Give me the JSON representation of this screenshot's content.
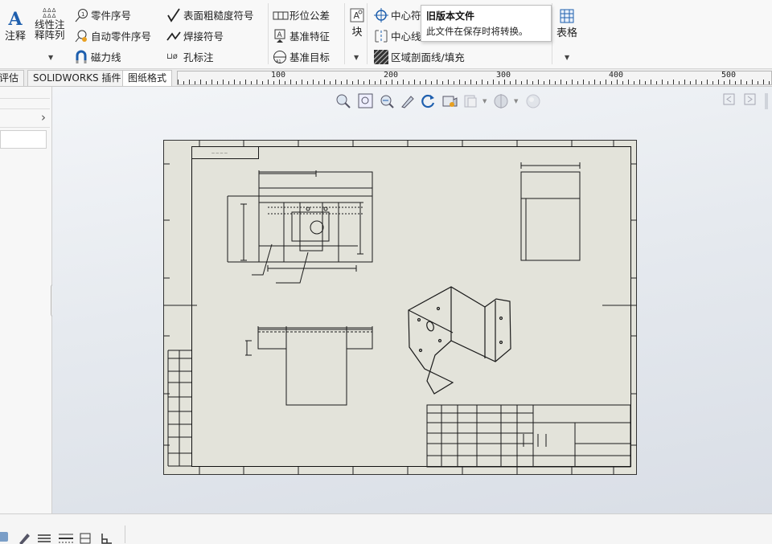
{
  "ribbon": {
    "annotation": "注释",
    "linear_pattern": [
      "线性注",
      "释阵列"
    ],
    "balloon": "零件序号",
    "auto_balloon": "自动零件序号",
    "magnetic_line": "磁力线",
    "surface_finish": "表面粗糙度符号",
    "weld_symbol": "焊接符号",
    "hole_callout": "孔标注",
    "geometric_tolerance": "形位公差",
    "datum_feature": "基准特征",
    "datum_target": "基准目标",
    "block": "块",
    "center_mark": "中心符",
    "centerline": "中心线",
    "area_hatch": "区域剖面线/填充",
    "table": "表格",
    "tooltip_title": "旧版本文件",
    "tooltip_text": "此文件在保存时将转换。"
  },
  "tabs": [
    "评估",
    "SOLIDWORKS 插件",
    "图纸格式"
  ],
  "ruler_labels": [
    "100",
    "200",
    "300",
    "400",
    "500"
  ],
  "colors": {
    "sheet": "#e3e3da",
    "line": "#1a1a1a",
    "accent": "#1e5fae"
  }
}
